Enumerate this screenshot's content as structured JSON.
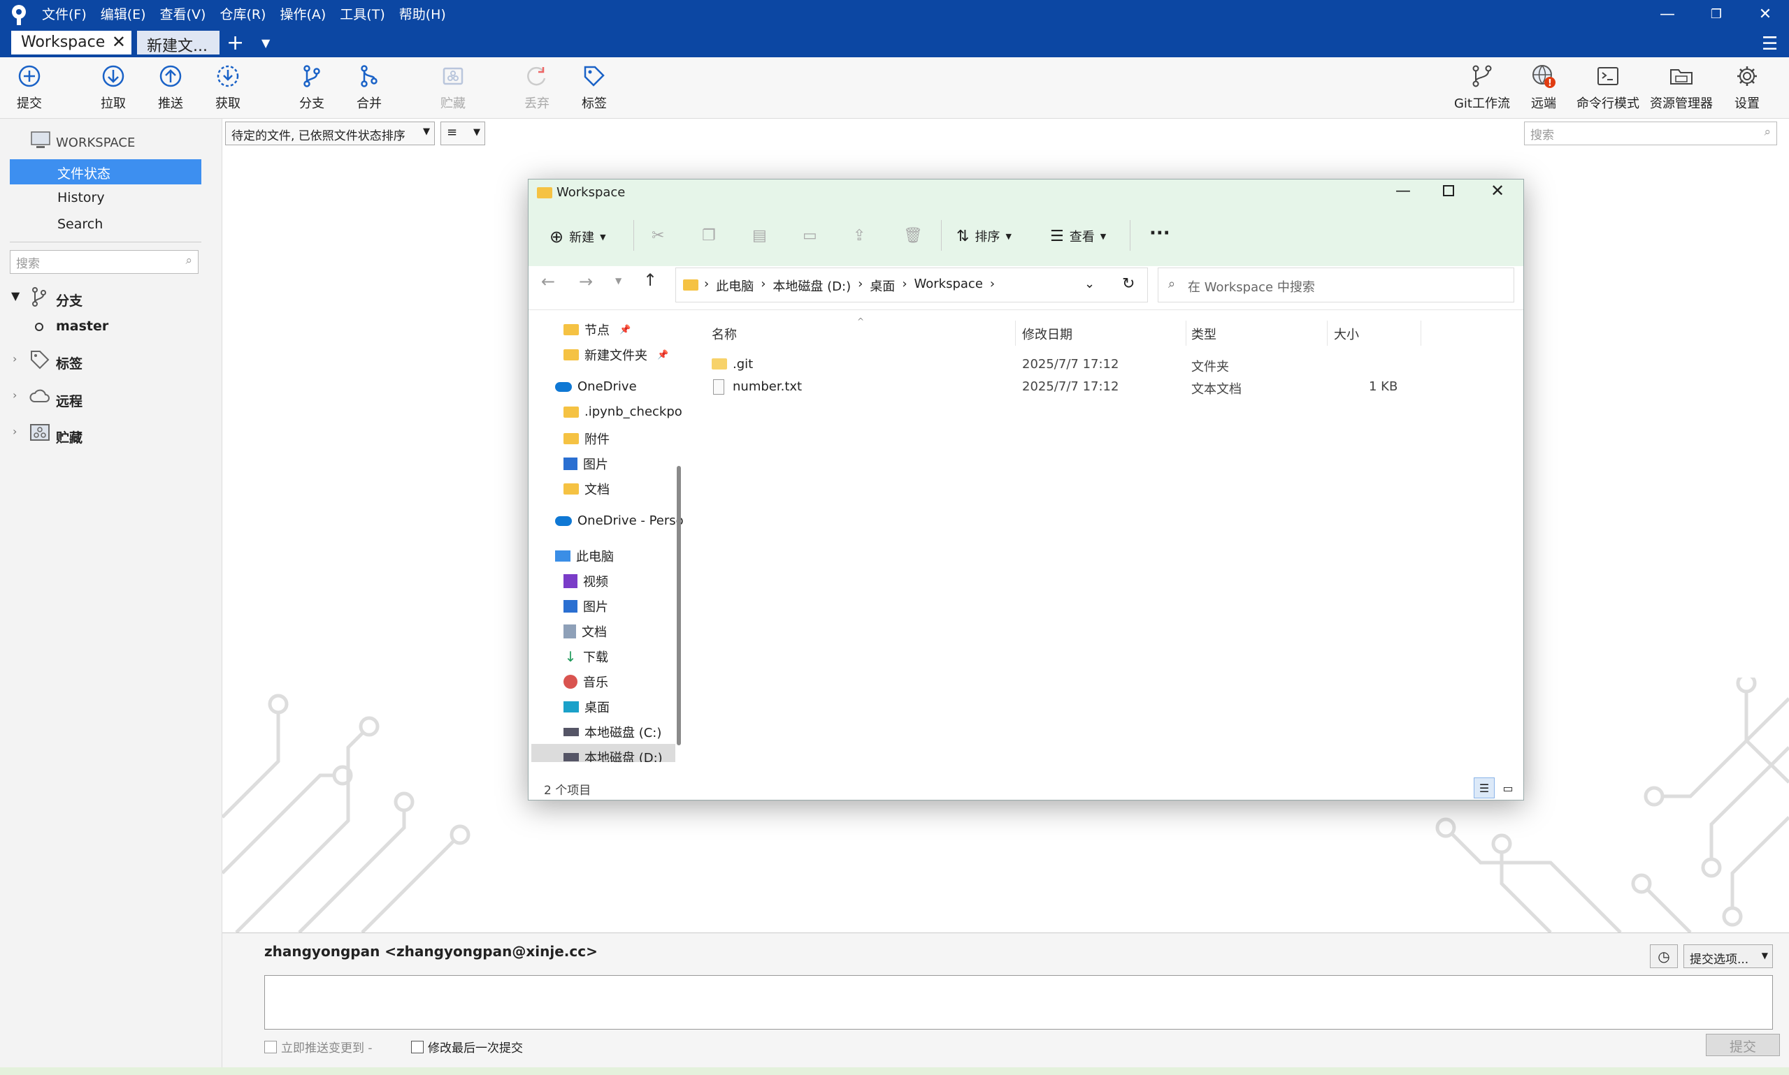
{
  "menu": [
    "文件(F)",
    "编辑(E)",
    "查看(V)",
    "仓库(R)",
    "操作(A)",
    "工具(T)",
    "帮助(H)"
  ],
  "tabs": {
    "active": "Workspace",
    "second": "新建文..."
  },
  "toolbar": {
    "commit": "提交",
    "pull": "拉取",
    "push": "推送",
    "fetch": "获取",
    "branch": "分支",
    "merge": "合并",
    "stash": "贮藏",
    "discard": "丢弃",
    "tag": "标签",
    "gitflow": "Git工作流",
    "remote": "远端",
    "terminal": "命令行模式",
    "explorer": "资源管理器",
    "settings": "设置"
  },
  "sidebar": {
    "workspace": "WORKSPACE",
    "file_status": "文件状态",
    "history": "History",
    "search": "Search",
    "search_placeholder": "搜索",
    "branches": "分支",
    "master": "master",
    "tags": "标签",
    "remotes": "远程",
    "stashes": "贮藏"
  },
  "main": {
    "filter": "待定的文件, 已依照文件状态排序",
    "view_icon": "≡",
    "search_placeholder": "搜索"
  },
  "explorer": {
    "title": "Workspace",
    "new": "新建",
    "sort": "排序",
    "view": "查看",
    "more": "···",
    "breadcrumb": [
      "此电脑",
      "本地磁盘 (D:)",
      "桌面",
      "Workspace"
    ],
    "search_placeholder": "在 Workspace 中搜索",
    "nav": [
      "节点",
      "新建文件夹",
      "OneDrive",
      ".ipynb_checkpo",
      "附件",
      "图片",
      "文档",
      "OneDrive - Perso",
      "此电脑",
      "视频",
      "图片",
      "文档",
      "下载",
      "音乐",
      "桌面",
      "本地磁盘 (C:)",
      "本地磁盘 (D:)"
    ],
    "columns": {
      "name": "名称",
      "date": "修改日期",
      "type": "类型",
      "size": "大小"
    },
    "files": [
      {
        "name": ".git",
        "date": "2025/7/7 17:12",
        "type": "文件夹",
        "size": ""
      },
      {
        "name": "number.txt",
        "date": "2025/7/7 17:12",
        "type": "文本文档",
        "size": "1 KB"
      }
    ],
    "status": "2 个项目"
  },
  "commit": {
    "author": "zhangyongpan <zhangyongpan@xinje.cc>",
    "options": "提交选项...",
    "push_now": "立即推送变更到 -",
    "amend": "修改最后一次提交",
    "submit": "提交"
  }
}
